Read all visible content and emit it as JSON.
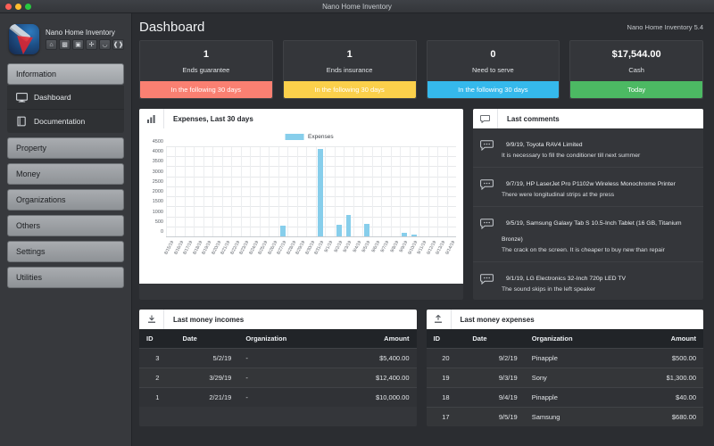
{
  "window": {
    "title": "Nano Home Inventory"
  },
  "sidebar": {
    "brand_name": "Nano Home Inventory",
    "tools": [
      "home-icon",
      "chart-icon",
      "box-icon",
      "wrench-icon",
      "comment-icon",
      "share-icon"
    ],
    "groups": [
      {
        "label": "Information",
        "active": true,
        "items": [
          {
            "label": "Dashboard",
            "icon": "monitor-icon"
          },
          {
            "label": "Documentation",
            "icon": "book-icon"
          }
        ]
      },
      {
        "label": "Property",
        "active": false,
        "items": []
      },
      {
        "label": "Money",
        "active": false,
        "items": []
      },
      {
        "label": "Organizations",
        "active": false,
        "items": []
      },
      {
        "label": "Others",
        "active": false,
        "items": []
      },
      {
        "label": "Settings",
        "active": false,
        "items": []
      },
      {
        "label": "Utilities",
        "active": false,
        "items": []
      }
    ]
  },
  "header": {
    "page_title": "Dashboard",
    "version": "Nano Home Inventory 5.4"
  },
  "kpis": [
    {
      "value": "1",
      "label": "Ends guarantee",
      "badge": "In the following 30 days",
      "color": "#fa8072"
    },
    {
      "value": "1",
      "label": "Ends insurance",
      "badge": "In the following 30 days",
      "color": "#fbd04b"
    },
    {
      "value": "0",
      "label": "Need to serve",
      "badge": "In the following 30 days",
      "color": "#35b9ec"
    },
    {
      "value": "$17,544.00",
      "label": "Cash",
      "badge": "Today",
      "color": "#4cb963"
    }
  ],
  "chart_panel": {
    "title": "Expenses, Last 30 days",
    "icon": "bar-chart-icon"
  },
  "chart_data": {
    "type": "bar",
    "title": "Expenses, Last 30 days",
    "xlabel": "",
    "ylabel": "",
    "ylim": [
      0,
      4500
    ],
    "yticks": [
      0,
      500,
      1000,
      1500,
      2000,
      2500,
      3000,
      3500,
      4000,
      4500
    ],
    "grid": true,
    "legend": [
      "Expenses"
    ],
    "legend_position": "top-center",
    "bar_color": "#87ceeb",
    "categories": [
      "8/15/19",
      "8/16/19",
      "8/17/19",
      "8/18/19",
      "8/19/19",
      "8/20/19",
      "8/21/19",
      "8/22/19",
      "8/23/19",
      "8/24/19",
      "8/25/19",
      "8/26/19",
      "8/27/19",
      "8/28/19",
      "8/29/19",
      "8/30/19",
      "8/31/19",
      "9/1/19",
      "9/2/19",
      "9/3/19",
      "9/4/19",
      "9/5/19",
      "9/6/19",
      "9/7/19",
      "9/8/19",
      "9/9/19",
      "9/10/19",
      "9/11/19",
      "9/12/19",
      "9/13/19",
      "9/14/19"
    ],
    "values": [
      0,
      0,
      0,
      0,
      0,
      0,
      0,
      0,
      0,
      0,
      0,
      0,
      570,
      0,
      0,
      0,
      4420,
      0,
      620,
      1120,
      60,
      680,
      0,
      40,
      0,
      230,
      150,
      0,
      0,
      0,
      0
    ]
  },
  "comments_panel": {
    "title": "Last comments",
    "icon": "comment-icon",
    "items": [
      {
        "meta": "9/9/19, Toyota RAV4 Limited",
        "text": "It is necessary to fill the conditioner till next summer"
      },
      {
        "meta": "9/7/19, HP LaserJet Pro P1102w Wireless Monochrome Printer",
        "text": "There were longitudinal strips at the press"
      },
      {
        "meta": "9/5/19, Samsung Galaxy Tab S 10.5-Inch Tablet (16 GB, Titanium Bronze)",
        "text": "The crack on the screen. It is cheaper to buy new than repair"
      },
      {
        "meta": "9/1/19, LG Electronics 32-Inch 720p LED TV",
        "text": "The sound skips in the left speaker"
      }
    ]
  },
  "incomes_panel": {
    "title": "Last money incomes",
    "icon": "download-icon",
    "columns": [
      "ID",
      "Date",
      "Organization",
      "Amount"
    ],
    "rows": [
      {
        "id": "3",
        "date": "5/2/19",
        "organization": "-",
        "amount": "$5,400.00"
      },
      {
        "id": "2",
        "date": "3/29/19",
        "organization": "-",
        "amount": "$12,400.00"
      },
      {
        "id": "1",
        "date": "2/21/19",
        "organization": "-",
        "amount": "$10,000.00"
      }
    ]
  },
  "expenses_panel": {
    "title": "Last money expenses",
    "icon": "upload-icon",
    "columns": [
      "ID",
      "Date",
      "Organization",
      "Amount"
    ],
    "rows": [
      {
        "id": "20",
        "date": "9/2/19",
        "organization": "Pinapple",
        "amount": "$500.00"
      },
      {
        "id": "19",
        "date": "9/3/19",
        "organization": "Sony",
        "amount": "$1,300.00"
      },
      {
        "id": "18",
        "date": "9/4/19",
        "organization": "Pinapple",
        "amount": "$40.00"
      },
      {
        "id": "17",
        "date": "9/5/19",
        "organization": "Samsung",
        "amount": "$680.00"
      }
    ]
  }
}
